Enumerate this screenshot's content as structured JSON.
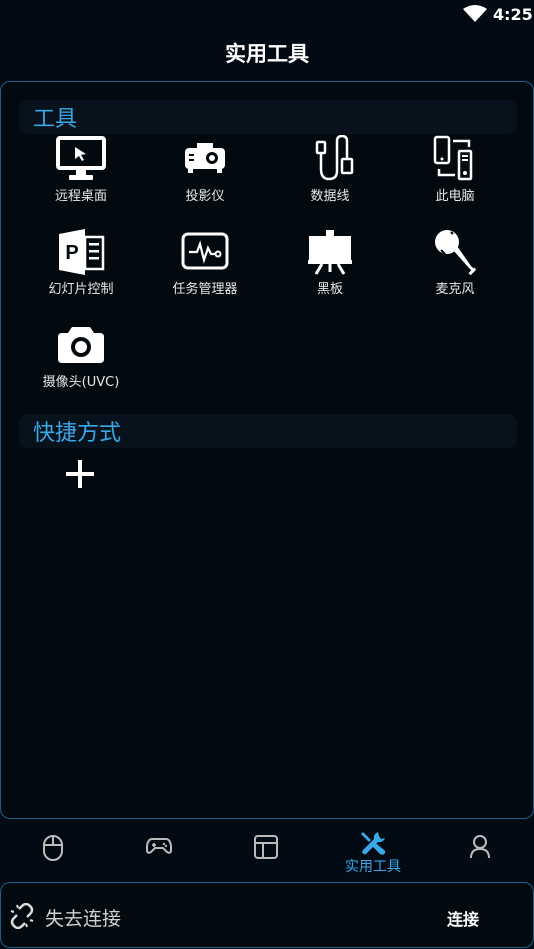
{
  "status_bar": {
    "time": "4:25"
  },
  "header": {
    "title": "实用工具"
  },
  "sections": {
    "tools_title": "工具",
    "shortcuts_title": "快捷方式"
  },
  "tools": [
    {
      "label": "远程桌面",
      "icon": "monitor-icon"
    },
    {
      "label": "投影仪",
      "icon": "projector-icon"
    },
    {
      "label": "数据线",
      "icon": "usb-cable-icon"
    },
    {
      "label": "此电脑",
      "icon": "devices-icon"
    },
    {
      "label": "幻灯片控制",
      "icon": "powerpoint-icon"
    },
    {
      "label": "任务管理器",
      "icon": "pulse-monitor-icon"
    },
    {
      "label": "黑板",
      "icon": "easel-board-icon"
    },
    {
      "label": "麦克风",
      "icon": "microphone-icon"
    },
    {
      "label": "摄像头(UVC)",
      "icon": "camera-icon"
    }
  ],
  "nav": [
    {
      "icon": "mouse-icon",
      "label": ""
    },
    {
      "icon": "gamepad-icon",
      "label": ""
    },
    {
      "icon": "layout-icon",
      "label": ""
    },
    {
      "icon": "wrench-icon",
      "label": "实用工具",
      "active": true
    },
    {
      "icon": "user-icon",
      "label": ""
    }
  ],
  "connection": {
    "status": "失去连接",
    "connect_label": "连接"
  },
  "colors": {
    "accent": "#3aa7e6",
    "border": "#1c5f8d",
    "background": "#020a14"
  }
}
